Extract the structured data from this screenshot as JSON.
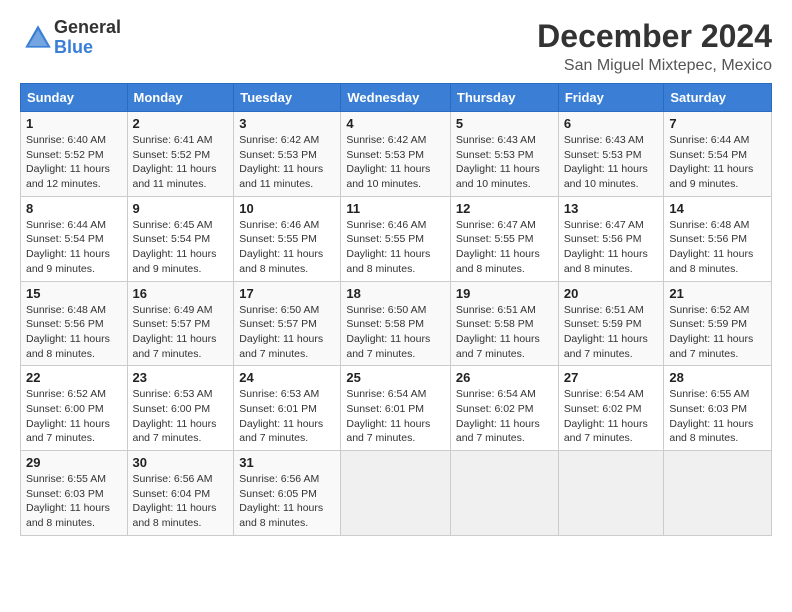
{
  "logo": {
    "general": "General",
    "blue": "Blue"
  },
  "title": "December 2024",
  "location": "San Miguel Mixtepec, Mexico",
  "days_of_week": [
    "Sunday",
    "Monday",
    "Tuesday",
    "Wednesday",
    "Thursday",
    "Friday",
    "Saturday"
  ],
  "weeks": [
    [
      {
        "day": "1",
        "info": "Sunrise: 6:40 AM\nSunset: 5:52 PM\nDaylight: 11 hours and 12 minutes."
      },
      {
        "day": "2",
        "info": "Sunrise: 6:41 AM\nSunset: 5:52 PM\nDaylight: 11 hours and 11 minutes."
      },
      {
        "day": "3",
        "info": "Sunrise: 6:42 AM\nSunset: 5:53 PM\nDaylight: 11 hours and 11 minutes."
      },
      {
        "day": "4",
        "info": "Sunrise: 6:42 AM\nSunset: 5:53 PM\nDaylight: 11 hours and 10 minutes."
      },
      {
        "day": "5",
        "info": "Sunrise: 6:43 AM\nSunset: 5:53 PM\nDaylight: 11 hours and 10 minutes."
      },
      {
        "day": "6",
        "info": "Sunrise: 6:43 AM\nSunset: 5:53 PM\nDaylight: 11 hours and 10 minutes."
      },
      {
        "day": "7",
        "info": "Sunrise: 6:44 AM\nSunset: 5:54 PM\nDaylight: 11 hours and 9 minutes."
      }
    ],
    [
      {
        "day": "8",
        "info": "Sunrise: 6:44 AM\nSunset: 5:54 PM\nDaylight: 11 hours and 9 minutes."
      },
      {
        "day": "9",
        "info": "Sunrise: 6:45 AM\nSunset: 5:54 PM\nDaylight: 11 hours and 9 minutes."
      },
      {
        "day": "10",
        "info": "Sunrise: 6:46 AM\nSunset: 5:55 PM\nDaylight: 11 hours and 8 minutes."
      },
      {
        "day": "11",
        "info": "Sunrise: 6:46 AM\nSunset: 5:55 PM\nDaylight: 11 hours and 8 minutes."
      },
      {
        "day": "12",
        "info": "Sunrise: 6:47 AM\nSunset: 5:55 PM\nDaylight: 11 hours and 8 minutes."
      },
      {
        "day": "13",
        "info": "Sunrise: 6:47 AM\nSunset: 5:56 PM\nDaylight: 11 hours and 8 minutes."
      },
      {
        "day": "14",
        "info": "Sunrise: 6:48 AM\nSunset: 5:56 PM\nDaylight: 11 hours and 8 minutes."
      }
    ],
    [
      {
        "day": "15",
        "info": "Sunrise: 6:48 AM\nSunset: 5:56 PM\nDaylight: 11 hours and 8 minutes."
      },
      {
        "day": "16",
        "info": "Sunrise: 6:49 AM\nSunset: 5:57 PM\nDaylight: 11 hours and 7 minutes."
      },
      {
        "day": "17",
        "info": "Sunrise: 6:50 AM\nSunset: 5:57 PM\nDaylight: 11 hours and 7 minutes."
      },
      {
        "day": "18",
        "info": "Sunrise: 6:50 AM\nSunset: 5:58 PM\nDaylight: 11 hours and 7 minutes."
      },
      {
        "day": "19",
        "info": "Sunrise: 6:51 AM\nSunset: 5:58 PM\nDaylight: 11 hours and 7 minutes."
      },
      {
        "day": "20",
        "info": "Sunrise: 6:51 AM\nSunset: 5:59 PM\nDaylight: 11 hours and 7 minutes."
      },
      {
        "day": "21",
        "info": "Sunrise: 6:52 AM\nSunset: 5:59 PM\nDaylight: 11 hours and 7 minutes."
      }
    ],
    [
      {
        "day": "22",
        "info": "Sunrise: 6:52 AM\nSunset: 6:00 PM\nDaylight: 11 hours and 7 minutes."
      },
      {
        "day": "23",
        "info": "Sunrise: 6:53 AM\nSunset: 6:00 PM\nDaylight: 11 hours and 7 minutes."
      },
      {
        "day": "24",
        "info": "Sunrise: 6:53 AM\nSunset: 6:01 PM\nDaylight: 11 hours and 7 minutes."
      },
      {
        "day": "25",
        "info": "Sunrise: 6:54 AM\nSunset: 6:01 PM\nDaylight: 11 hours and 7 minutes."
      },
      {
        "day": "26",
        "info": "Sunrise: 6:54 AM\nSunset: 6:02 PM\nDaylight: 11 hours and 7 minutes."
      },
      {
        "day": "27",
        "info": "Sunrise: 6:54 AM\nSunset: 6:02 PM\nDaylight: 11 hours and 7 minutes."
      },
      {
        "day": "28",
        "info": "Sunrise: 6:55 AM\nSunset: 6:03 PM\nDaylight: 11 hours and 8 minutes."
      }
    ],
    [
      {
        "day": "29",
        "info": "Sunrise: 6:55 AM\nSunset: 6:03 PM\nDaylight: 11 hours and 8 minutes."
      },
      {
        "day": "30",
        "info": "Sunrise: 6:56 AM\nSunset: 6:04 PM\nDaylight: 11 hours and 8 minutes."
      },
      {
        "day": "31",
        "info": "Sunrise: 6:56 AM\nSunset: 6:05 PM\nDaylight: 11 hours and 8 minutes."
      },
      {
        "day": "",
        "info": ""
      },
      {
        "day": "",
        "info": ""
      },
      {
        "day": "",
        "info": ""
      },
      {
        "day": "",
        "info": ""
      }
    ]
  ]
}
